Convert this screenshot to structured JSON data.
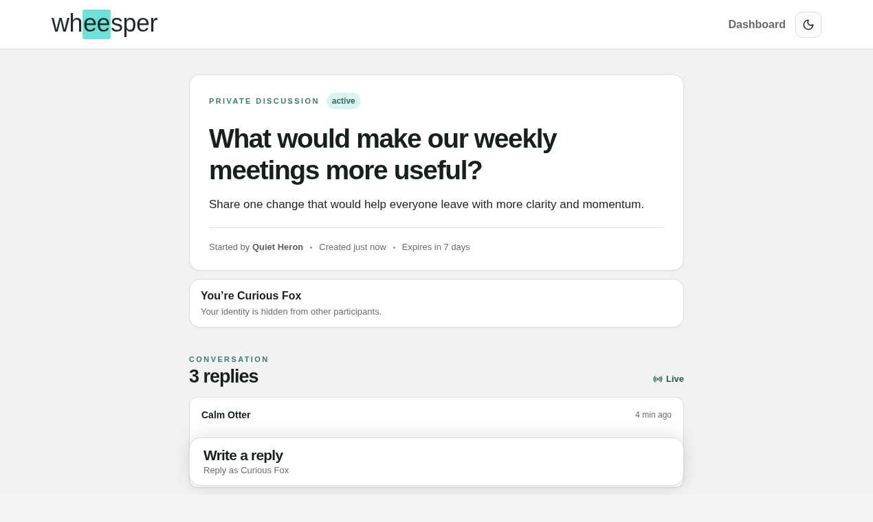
{
  "header": {
    "logo": {
      "parts": [
        {
          "text": "wh",
          "highlighted": false
        },
        {
          "text": "ee",
          "highlighted": true
        },
        {
          "text": "sper",
          "highlighted": false
        }
      ]
    },
    "nav": [
      {
        "label": "Dashboard"
      }
    ]
  },
  "discussion": {
    "eyebrow": "PRIVATE DISCUSSION",
    "status": "active",
    "title": "What would make our weekly meetings more useful?",
    "description": "Share one change that would help everyone leave with more clarity and momentum.",
    "meta": [
      "Started by **Quiet Heron**",
      "Created just now",
      "Expires in 7 days"
    ]
  },
  "identity": {
    "title": "You’re Curious Fox",
    "note": "Your identity is hidden from other participants."
  },
  "conversation": {
    "eyebrow": "CONVERSATION",
    "count": "3 replies",
    "live": "Live",
    "replies": [
      {
        "author": "Calm Otter",
        "time": "4 min ago"
      }
    ]
  },
  "composer": {
    "title": "Write a reply",
    "subtitle": "Reply as Curious Fox"
  }
}
